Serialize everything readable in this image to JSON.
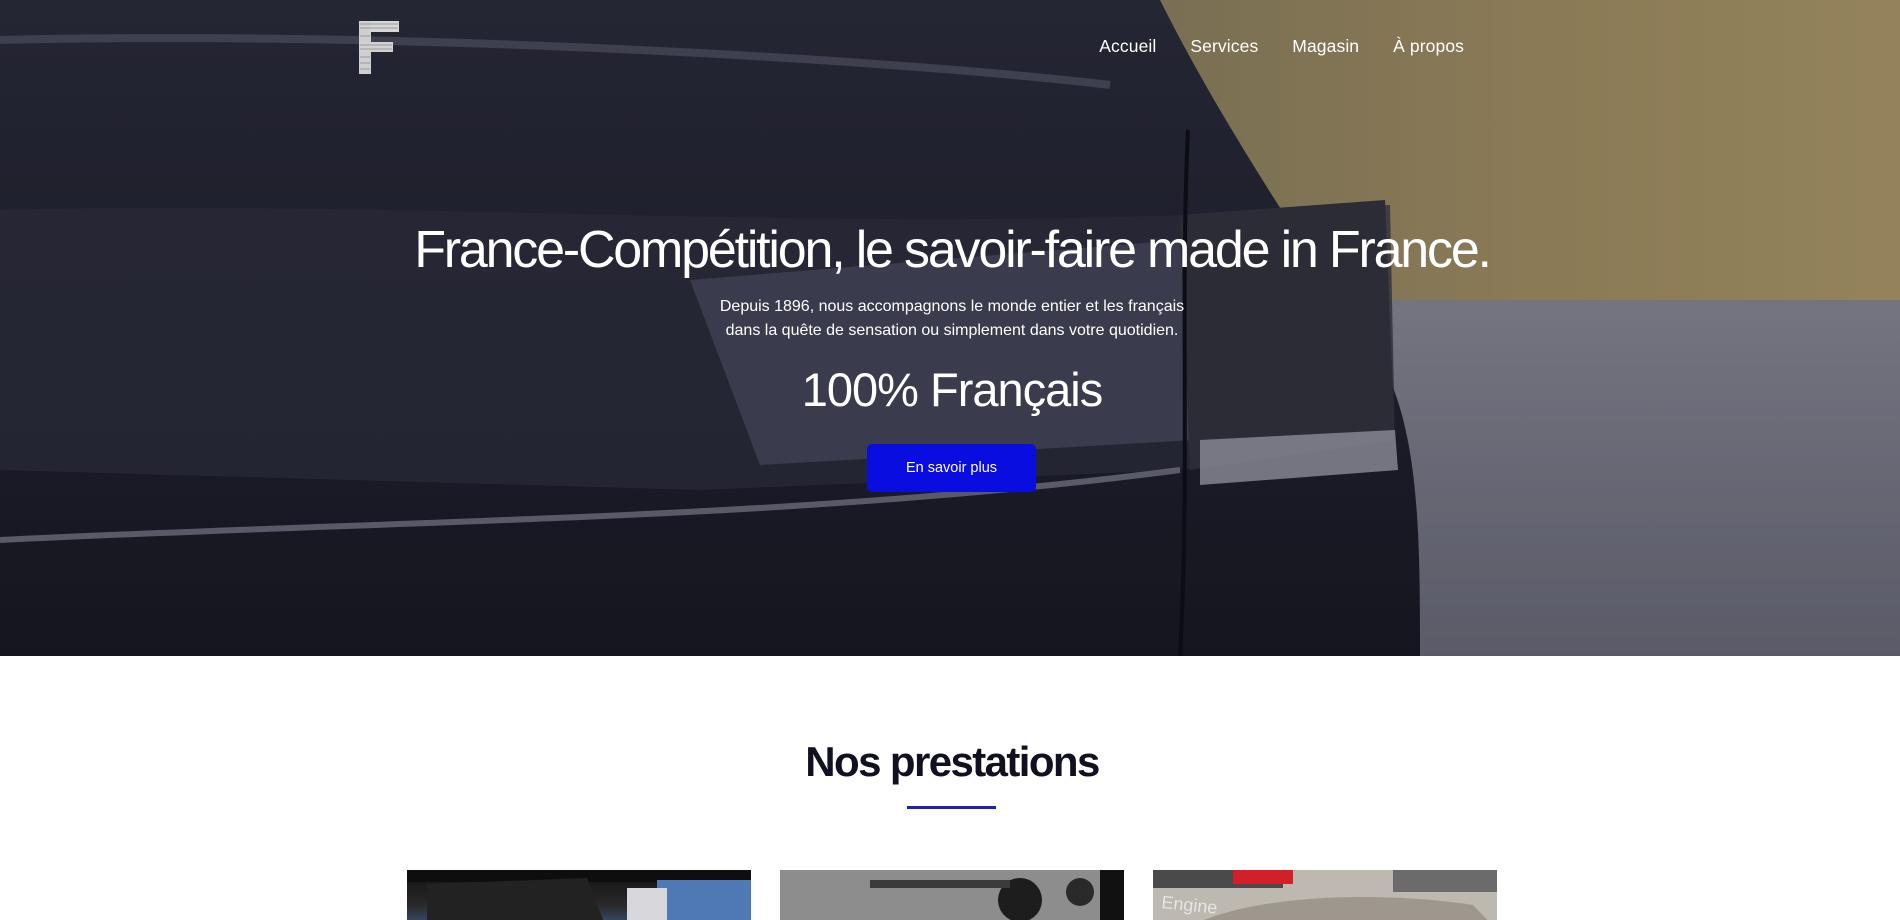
{
  "nav": {
    "items": [
      "Accueil",
      "Services",
      "Magasin",
      "À propos"
    ]
  },
  "hero": {
    "title": "France-Compétition, le savoir-faire made in France.",
    "subtitle_line1": "Depuis 1896, nous accompagnons le monde entier et les français",
    "subtitle_line2": "dans la quête de sensation ou simplement dans votre quotidien.",
    "tagline": "100% Français",
    "cta_label": "En savoir plus"
  },
  "section": {
    "title": "Nos prestations"
  },
  "cards": {
    "c3_text": "Engine"
  },
  "colors": {
    "accent": "#0a0ddf",
    "rule": "#1d1fb5"
  },
  "icons": {
    "logo": "F-logo"
  }
}
